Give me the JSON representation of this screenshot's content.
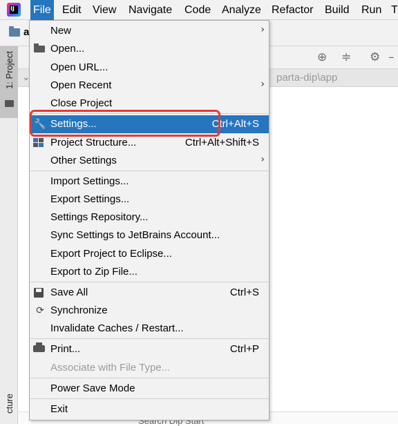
{
  "menubar": {
    "items": [
      "File",
      "Edit",
      "View",
      "Navigate",
      "Code",
      "Analyze",
      "Refactor",
      "Build",
      "Run",
      "T"
    ]
  },
  "toolbar": {
    "project_name": "a"
  },
  "path_bar": {
    "text": "parta-dip\\app"
  },
  "side_panel": {
    "project_tab": "1: Project",
    "structure_tab": "cture"
  },
  "status_bar": {
    "hint": "Search Dip Start"
  },
  "file_menu": {
    "items": [
      {
        "label": "New",
        "shortcut": "",
        "submenu": true
      },
      {
        "label": "Open...",
        "shortcut": "",
        "icon": "folder-open-icon"
      },
      {
        "label": "Open URL...",
        "shortcut": ""
      },
      {
        "label": "Open Recent",
        "shortcut": "",
        "submenu": true
      },
      {
        "label": "Close Project",
        "shortcut": ""
      },
      {
        "label": "Settings...",
        "shortcut": "Ctrl+Alt+S",
        "icon": "wrench-icon",
        "selected": true
      },
      {
        "label": "Project Structure...",
        "shortcut": "Ctrl+Alt+Shift+S",
        "icon": "project-structure-icon"
      },
      {
        "label": "Other Settings",
        "shortcut": "",
        "submenu": true
      },
      {
        "label": "Import Settings...",
        "shortcut": ""
      },
      {
        "label": "Export Settings...",
        "shortcut": ""
      },
      {
        "label": "Settings Repository...",
        "shortcut": ""
      },
      {
        "label": "Sync Settings to JetBrains Account...",
        "shortcut": ""
      },
      {
        "label": "Export Project to Eclipse...",
        "shortcut": ""
      },
      {
        "label": "Export to Zip File...",
        "shortcut": ""
      },
      {
        "label": "Save All",
        "shortcut": "Ctrl+S",
        "icon": "save-icon"
      },
      {
        "label": "Synchronize",
        "shortcut": "",
        "icon": "sync-icon"
      },
      {
        "label": "Invalidate Caches / Restart...",
        "shortcut": ""
      },
      {
        "label": "Print...",
        "shortcut": "Ctrl+P",
        "icon": "print-icon"
      },
      {
        "label": "Associate with File Type...",
        "shortcut": "",
        "disabled": true
      },
      {
        "label": "Power Save Mode",
        "shortcut": ""
      },
      {
        "label": "Exit",
        "shortcut": ""
      }
    ]
  },
  "colors": {
    "selection": "#2675bf",
    "highlight_box": "#e53935",
    "menu_bg": "#f2f2f2"
  }
}
